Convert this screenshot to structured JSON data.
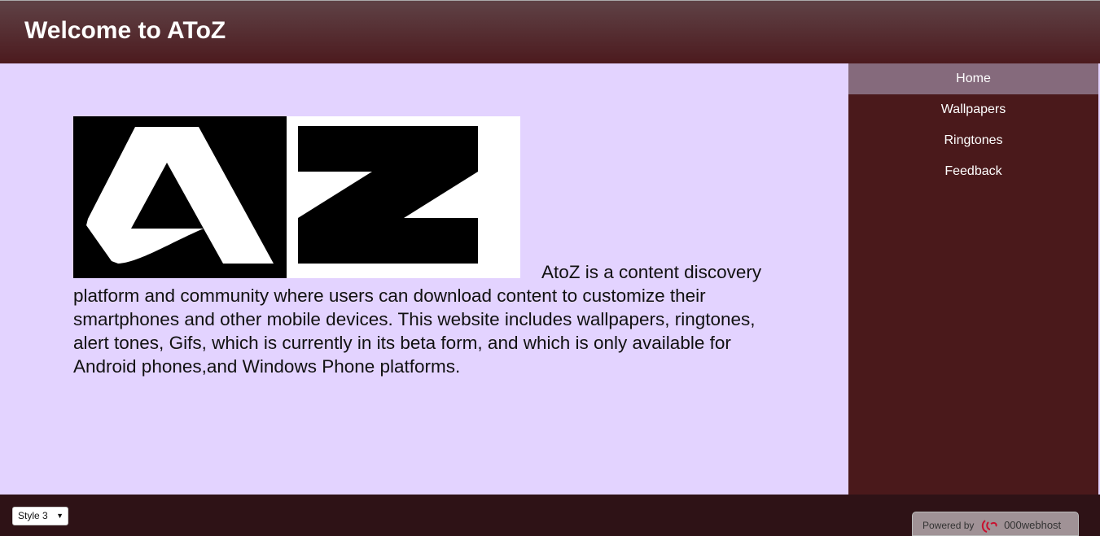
{
  "header": {
    "title": "Welcome to AToZ"
  },
  "main": {
    "logo_text": "AZ",
    "description": "AtoZ is a content discovery platform and community where users can download content to customize their smartphones and other mobile devices. This website includes wallpapers, ringtones, alert tones, Gifs, which is currently in its beta form, and which is only available for Android phones,and Windows Phone platforms."
  },
  "sidebar": {
    "items": [
      {
        "label": "Home",
        "active": true
      },
      {
        "label": "Wallpapers"
      },
      {
        "label": "Ringtones"
      },
      {
        "label": "Feedback"
      }
    ]
  },
  "footer": {
    "style_select": {
      "value": "Style 3"
    },
    "powered_by": "Powered by",
    "host_brand": "000webhost"
  },
  "colors": {
    "header": "#4c1a1e",
    "sidebar": "#4a191b",
    "active_nav": "#856a7c",
    "main_bg": "#e3d3ff",
    "footer": "#2e1216"
  }
}
